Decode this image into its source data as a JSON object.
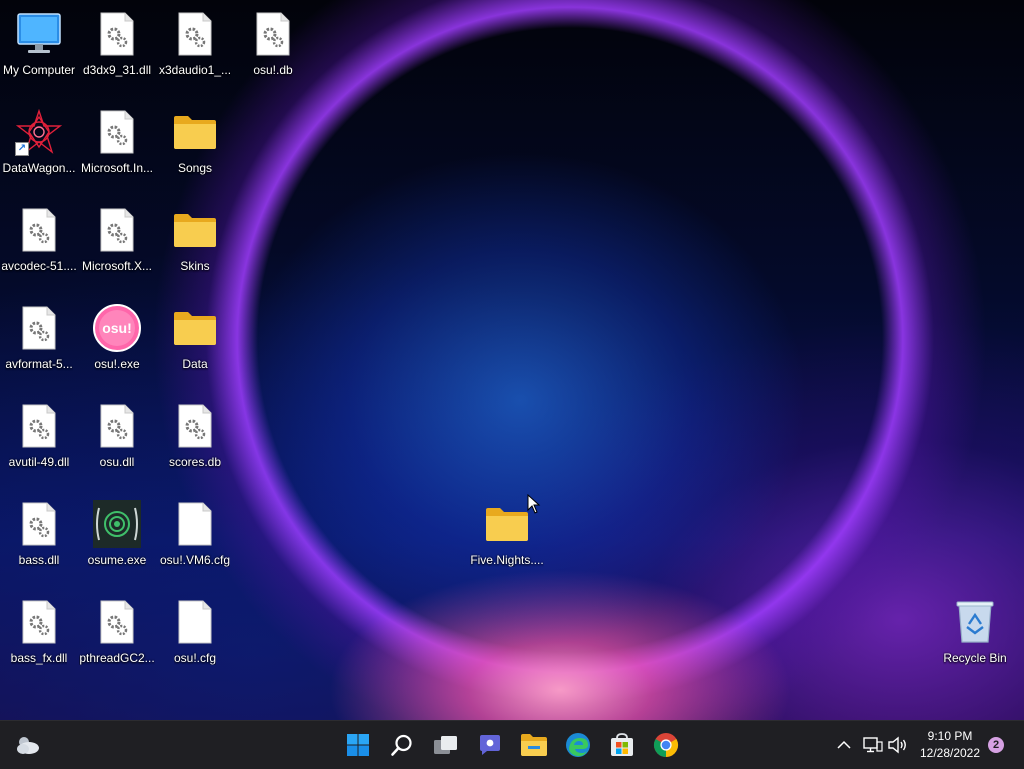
{
  "desktop": {
    "icons": [
      {
        "label": "My Computer",
        "type": "computer"
      },
      {
        "label": "d3dx9_31.dll",
        "type": "dll"
      },
      {
        "label": "x3daudio1_...",
        "type": "dll"
      },
      {
        "label": "osu!.db",
        "type": "dll"
      },
      {
        "label": "DataWagon...",
        "type": "datawagon"
      },
      {
        "label": "Microsoft.In...",
        "type": "dll"
      },
      {
        "label": "Songs",
        "type": "folder"
      },
      {
        "label": "avcodec-51....",
        "type": "dll"
      },
      {
        "label": "Microsoft.X...",
        "type": "dll"
      },
      {
        "label": "Skins",
        "type": "folder"
      },
      {
        "label": "avformat-5...",
        "type": "dll"
      },
      {
        "label": "osu!.exe",
        "type": "osu"
      },
      {
        "label": "Data",
        "type": "folder"
      },
      {
        "label": "avutil-49.dll",
        "type": "dll"
      },
      {
        "label": "osu.dll",
        "type": "dll"
      },
      {
        "label": "scores.db",
        "type": "dll"
      },
      {
        "label": "bass.dll",
        "type": "dll"
      },
      {
        "label": "osume.exe",
        "type": "osume"
      },
      {
        "label": "osu!.VM6.cfg",
        "type": "file"
      },
      {
        "label": "bass_fx.dll",
        "type": "dll"
      },
      {
        "label": "pthreadGC2...",
        "type": "dll"
      },
      {
        "label": "osu!.cfg",
        "type": "file"
      },
      {
        "label": "Five.Nights....",
        "type": "folder"
      },
      {
        "label": "Recycle Bin",
        "type": "recycle"
      }
    ]
  },
  "taskbar": {
    "weather_icon": "weather-cloud-icon",
    "apps": [
      {
        "name": "start",
        "icon": "windows-start-icon"
      },
      {
        "name": "search",
        "icon": "search-icon"
      },
      {
        "name": "task-view",
        "icon": "task-view-icon"
      },
      {
        "name": "chat",
        "icon": "teams-chat-icon"
      },
      {
        "name": "file-explorer",
        "icon": "folder-icon"
      },
      {
        "name": "edge",
        "icon": "edge-icon"
      },
      {
        "name": "store",
        "icon": "store-icon"
      },
      {
        "name": "chrome",
        "icon": "chrome-icon"
      }
    ],
    "tray": {
      "time": "9:10 PM",
      "date": "12/28/2022",
      "notification_count": "2"
    }
  },
  "colors": {
    "taskbar_bg": "#1f1f23",
    "folder_yellow": "#f4c542",
    "windows_blue": "#1a9bf0",
    "osu_pink": "#ff66aa",
    "badge": "#d6a1e3"
  }
}
